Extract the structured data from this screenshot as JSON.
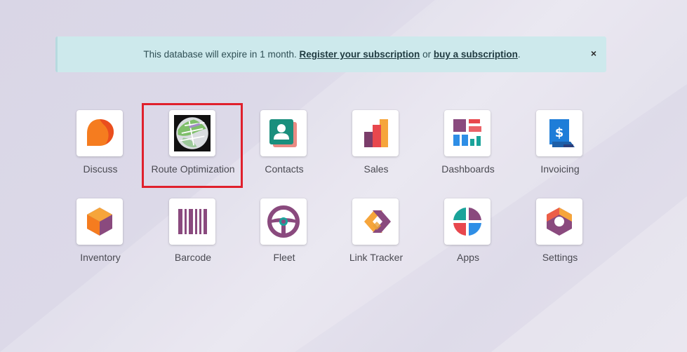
{
  "alert": {
    "text_before": "This database will expire in 1 month.",
    "register_link": "Register your subscription",
    "middle": "or",
    "buy_link": "buy a subscription",
    "end": ".",
    "close_glyph": "×"
  },
  "apps": [
    {
      "label": "Discuss",
      "icon": "discuss-icon"
    },
    {
      "label": "Route Optimization",
      "icon": "route-optimization-icon"
    },
    {
      "label": "Contacts",
      "icon": "contacts-icon"
    },
    {
      "label": "Sales",
      "icon": "sales-icon"
    },
    {
      "label": "Dashboards",
      "icon": "dashboards-icon"
    },
    {
      "label": "Invoicing",
      "icon": "invoicing-icon"
    },
    {
      "label": "Inventory",
      "icon": "inventory-icon"
    },
    {
      "label": "Barcode",
      "icon": "barcode-icon"
    },
    {
      "label": "Fleet",
      "icon": "fleet-icon"
    },
    {
      "label": "Link Tracker",
      "icon": "link-tracker-icon"
    },
    {
      "label": "Apps",
      "icon": "apps-icon"
    },
    {
      "label": "Settings",
      "icon": "settings-icon"
    }
  ],
  "colors": {
    "alert_bg": "#cde9ec",
    "highlight": "#e0202c",
    "odoo_purple": "#875a7b",
    "orange": "#f48a1f",
    "teal": "#1aa39a"
  }
}
